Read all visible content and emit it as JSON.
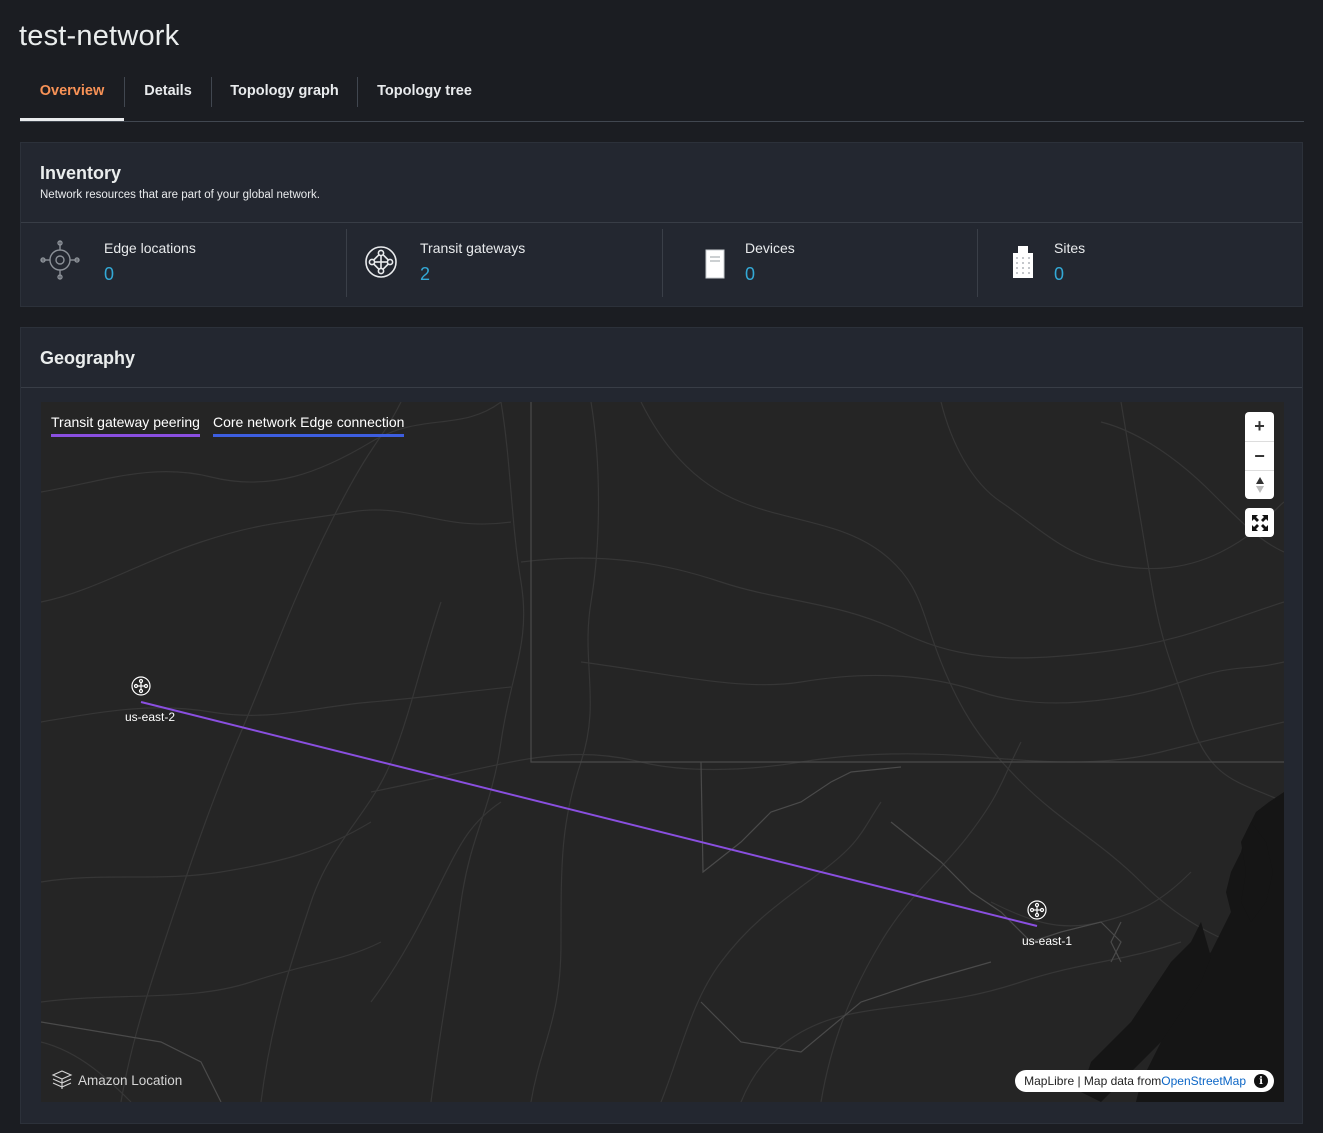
{
  "page": {
    "title": "test-network"
  },
  "tabs": [
    {
      "label": "Overview",
      "active": true
    },
    {
      "label": "Details",
      "active": false
    },
    {
      "label": "Topology graph",
      "active": false
    },
    {
      "label": "Topology tree",
      "active": false
    }
  ],
  "inventory": {
    "title": "Inventory",
    "description": "Network resources that are part of your global network.",
    "stats": [
      {
        "label": "Edge locations",
        "value": "0",
        "icon": "edge-location-icon"
      },
      {
        "label": "Transit gateways",
        "value": "2",
        "icon": "transit-gateway-icon"
      },
      {
        "label": "Devices",
        "value": "0",
        "icon": "device-icon"
      },
      {
        "label": "Sites",
        "value": "0",
        "icon": "site-building-icon"
      }
    ]
  },
  "geography": {
    "title": "Geography",
    "legend": [
      {
        "label": "Transit gateway peering",
        "color": "#8a4fe0"
      },
      {
        "label": "Core network Edge connection",
        "color": "#3d5ee0"
      }
    ],
    "nodes": [
      {
        "label": "us-east-2",
        "icon": "transit-gateway-icon"
      },
      {
        "label": "us-east-1",
        "icon": "transit-gateway-icon"
      }
    ],
    "controls": {
      "zoom_in": "+",
      "zoom_out": "−",
      "compass": "compass-icon",
      "fullscreen": "fullscreen-icon"
    },
    "attribution": {
      "prefix": "MapLibre | Map data from ",
      "link": "OpenStreetMap",
      "info": "i"
    },
    "branding": "Amazon Location"
  },
  "colors": {
    "accent_tab": "#f89256",
    "stat_value": "#33a9d6",
    "peering_line": "#8a4fe0",
    "edge_line": "#3d5ee0"
  }
}
